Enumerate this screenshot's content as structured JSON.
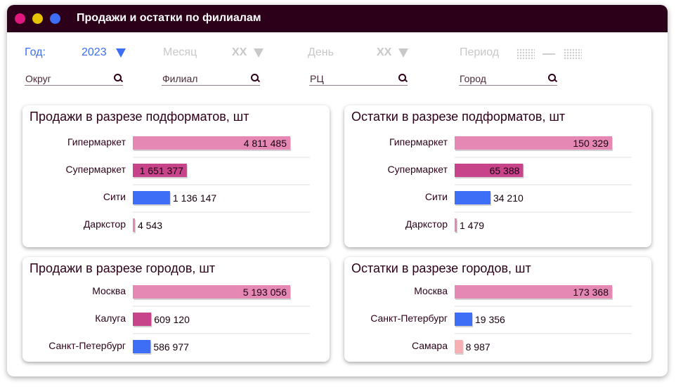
{
  "window": {
    "title": "Продажи и остатки по филиалам",
    "dots": [
      "#e0177f",
      "#e6c200",
      "#3d6ef5"
    ]
  },
  "filters": {
    "year_label": "Год:",
    "year_value": "2023",
    "month_label": "Месяц",
    "month_value": "XX",
    "day_label": "День",
    "day_value": "XX",
    "period_label": "Период"
  },
  "search": {
    "okrug": "Округ",
    "filial": "Филиал",
    "rc": "РЦ",
    "city": "Город"
  },
  "colors": {
    "active": "#3d6ef5",
    "pink": "#e688b4",
    "magenta": "#c7438a",
    "blue": "#3d6ef5",
    "salmon": "#f6b0b4",
    "text": "#2c0019"
  },
  "chart_data": [
    {
      "type": "bar",
      "title": "Продажи в разрезе подформатов, шт",
      "categories": [
        "Гипермаркет",
        "Супермаркет",
        "Сити",
        "Даркстор"
      ],
      "values": [
        4811485,
        1651377,
        1136147,
        4543
      ],
      "labels": [
        "4 811 485",
        "1 651 377",
        "1 136 147",
        "4 543"
      ],
      "colors": [
        "#e688b4",
        "#c7438a",
        "#3d6ef5",
        "#e688b4"
      ]
    },
    {
      "type": "bar",
      "title": "Остатки в разрезе подформатов, шт",
      "categories": [
        "Гипермаркет",
        "Супермаркет",
        "Сити",
        "Даркстор"
      ],
      "values": [
        150329,
        65388,
        34210,
        1479
      ],
      "labels": [
        "150 329",
        "65 388",
        "34 210",
        "1 479"
      ],
      "colors": [
        "#e688b4",
        "#c7438a",
        "#3d6ef5",
        "#e688b4"
      ]
    },
    {
      "type": "bar",
      "title": "Продажи в разрезе городов, шт",
      "categories": [
        "Москва",
        "Калуга",
        "Санкт-Петербург"
      ],
      "values": [
        5193056,
        609120,
        586977
      ],
      "labels": [
        "5 193 056",
        "609 120",
        "586 977"
      ],
      "colors": [
        "#e688b4",
        "#c7438a",
        "#3d6ef5"
      ]
    },
    {
      "type": "bar",
      "title": "Остатки в разрезе городов, шт",
      "categories": [
        "Москва",
        "Санкт-Петербург",
        "Самара"
      ],
      "values": [
        173368,
        19356,
        8987
      ],
      "labels": [
        "173 368",
        "19 356",
        "8 987"
      ],
      "colors": [
        "#e688b4",
        "#3d6ef5",
        "#f6b0b4"
      ]
    }
  ]
}
